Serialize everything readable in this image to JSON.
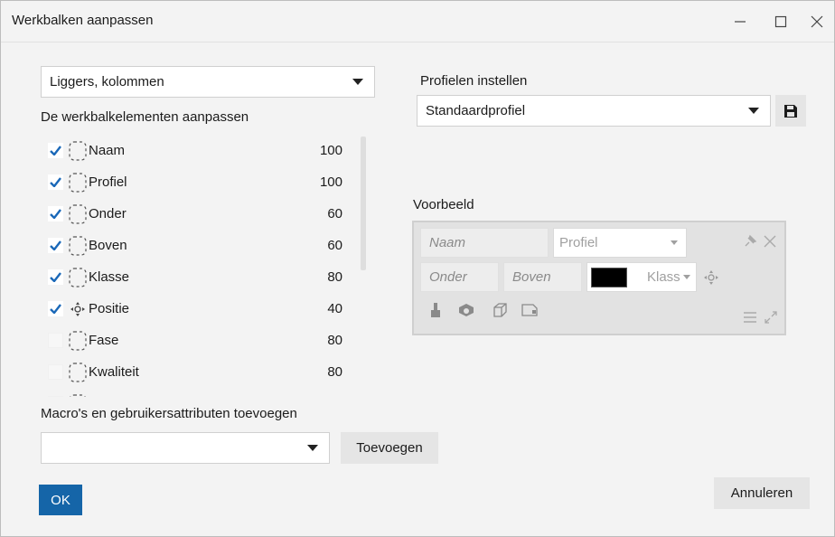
{
  "window": {
    "title": "Werkbalken aanpassen",
    "controls": [
      "minimize",
      "maximize",
      "close"
    ]
  },
  "left": {
    "type_select": {
      "value": "Liggers, kolommen"
    },
    "customize_label": "De werkbalkelementen aanpassen",
    "items": [
      {
        "checked": true,
        "icon": "placeholder-icon",
        "name": "Naam",
        "width": "100"
      },
      {
        "checked": true,
        "icon": "placeholder-icon",
        "name": "Profiel",
        "width": "100"
      },
      {
        "checked": true,
        "icon": "placeholder-icon",
        "name": "Onder",
        "width": "60"
      },
      {
        "checked": true,
        "icon": "placeholder-icon",
        "name": "Boven",
        "width": "60"
      },
      {
        "checked": true,
        "icon": "placeholder-icon",
        "name": "Klasse",
        "width": "80"
      },
      {
        "checked": true,
        "icon": "position-icon",
        "name": "Positie",
        "width": "40"
      },
      {
        "checked": false,
        "icon": "placeholder-icon",
        "name": "Fase",
        "width": "80"
      },
      {
        "checked": false,
        "icon": "placeholder-icon",
        "name": "Kwaliteit",
        "width": "80"
      },
      {
        "checked": false,
        "icon": "placeholder-icon",
        "name": "",
        "width": ""
      }
    ],
    "macro_label": "Macro's en gebruikersattributen toevoegen",
    "macro_select": {
      "value": ""
    },
    "add_button": "Toevoegen"
  },
  "right": {
    "profiles_label": "Profielen instellen",
    "profile_select": {
      "value": "Standaardprofiel"
    },
    "save_icon": "save-icon",
    "preview_label": "Voorbeeld",
    "preview": {
      "naam": "Naam",
      "profiel": "Profiel",
      "onder": "Onder",
      "boven": "Boven",
      "klasse": "Klass",
      "color_swatch": "#000000"
    }
  },
  "footer": {
    "ok": "OK",
    "cancel": "Annuleren"
  },
  "colors": {
    "accent": "#1565a8",
    "check": "#1a68b8"
  }
}
